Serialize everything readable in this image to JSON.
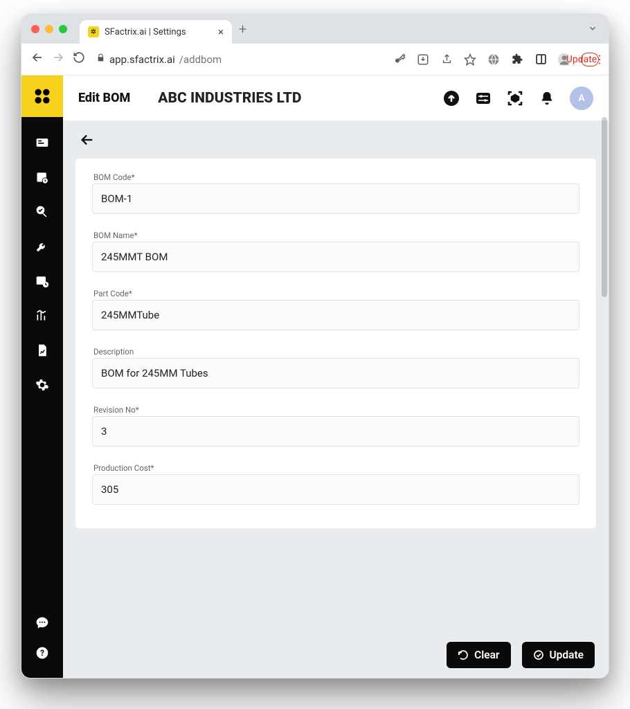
{
  "browser": {
    "tab_title": "SFactrix.ai | Settings",
    "url_host": "app.sfactrix.ai",
    "url_path": "/addbom",
    "update_label": "Update"
  },
  "header": {
    "page_title": "Edit BOM",
    "company": "ABC INDUSTRIES LTD",
    "avatar_letter": "A"
  },
  "form": {
    "bom_code": {
      "label": "BOM Code*",
      "value": "BOM-1"
    },
    "bom_name": {
      "label": "BOM Name*",
      "value": "245MMT BOM"
    },
    "part_code": {
      "label": "Part Code*",
      "value": "245MMTube"
    },
    "description": {
      "label": "Description",
      "value": "BOM for 245MM Tubes"
    },
    "revision_no": {
      "label": "Revision No*",
      "value": "3"
    },
    "production_cost": {
      "label": "Production Cost*",
      "value": "305"
    }
  },
  "actions": {
    "clear": "Clear",
    "update": "Update"
  }
}
